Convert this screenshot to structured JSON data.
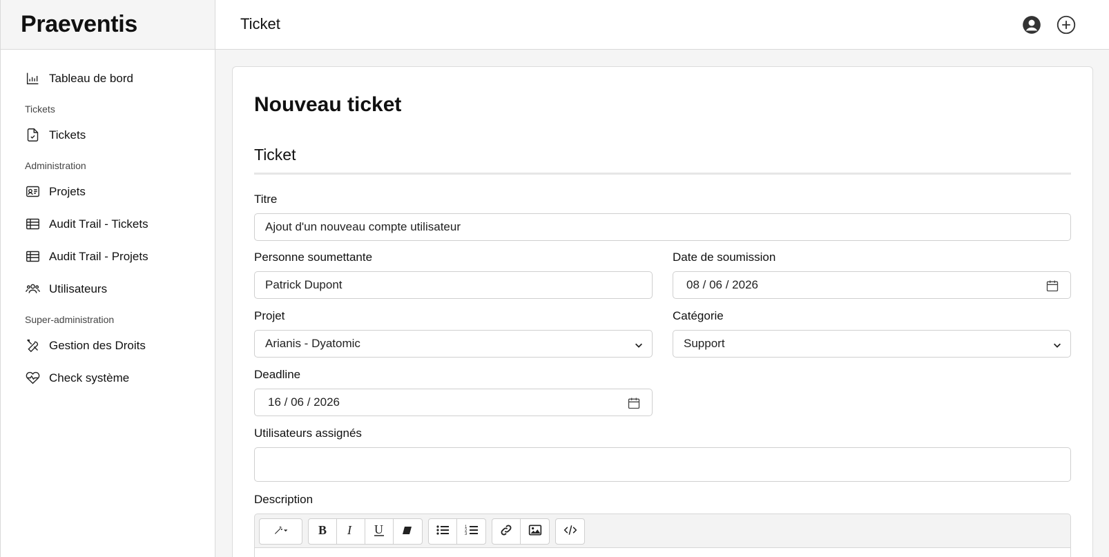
{
  "brand": "Praeventis",
  "topbar": {
    "title": "Ticket",
    "user_icon": "user-circle-icon",
    "add_icon": "plus-circle-icon"
  },
  "sidebar": {
    "dashboard": {
      "label": "Tableau de bord",
      "icon": "bar-chart-icon"
    },
    "sections": [
      {
        "title": "Tickets",
        "items": [
          {
            "label": "Tickets",
            "icon": "file-check-icon"
          }
        ]
      },
      {
        "title": "Administration",
        "items": [
          {
            "label": "Projets",
            "icon": "id-card-icon"
          },
          {
            "label": "Audit Trail - Tickets",
            "icon": "table-icon"
          },
          {
            "label": "Audit Trail - Projets",
            "icon": "table-icon"
          },
          {
            "label": "Utilisateurs",
            "icon": "users-icon"
          }
        ]
      },
      {
        "title": "Super-administration",
        "items": [
          {
            "label": "Gestion des Droits",
            "icon": "tools-icon"
          },
          {
            "label": "Check système",
            "icon": "heart-pulse-icon"
          }
        ]
      }
    ]
  },
  "form": {
    "heading": "Nouveau ticket",
    "section_title": "Ticket",
    "titre": {
      "label": "Titre",
      "value": "Ajout d'un nouveau compte utilisateur"
    },
    "personne": {
      "label": "Personne soumettante",
      "value": "Patrick Dupont"
    },
    "date_soumission": {
      "label": "Date de soumission",
      "value": "08 / 06 / 2026"
    },
    "projet": {
      "label": "Projet",
      "value": "Arianis - Dyatomic"
    },
    "categorie": {
      "label": "Catégorie",
      "value": "Support"
    },
    "deadline": {
      "label": "Deadline",
      "value": "16 / 06 / 2026"
    },
    "assignes": {
      "label": "Utilisateurs assignés",
      "value": ""
    },
    "description": {
      "label": "Description"
    }
  },
  "editor_toolbar": [
    "magic-style-icon",
    "bold-icon",
    "italic-icon",
    "underline-icon",
    "eraser-icon",
    "unordered-list-icon",
    "ordered-list-icon",
    "link-icon",
    "image-icon",
    "code-icon"
  ]
}
